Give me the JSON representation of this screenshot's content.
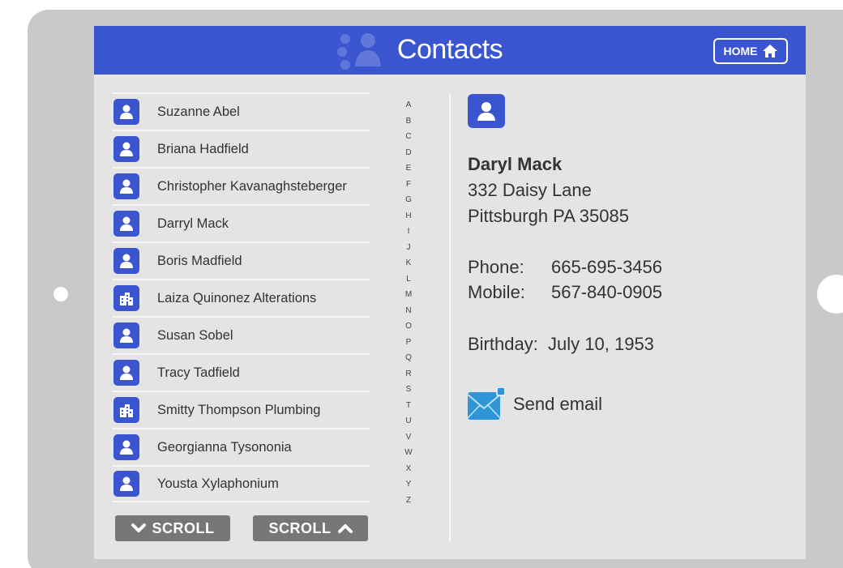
{
  "header": {
    "title": "Contacts",
    "home_label": "HOME"
  },
  "contacts": [
    {
      "name": "Suzanne Abel",
      "type": "person-icon"
    },
    {
      "name": "Briana Hadfield",
      "type": "person-icon"
    },
    {
      "name": "Christopher Kavanaghsteberger",
      "type": "person-icon"
    },
    {
      "name": "Darryl Mack",
      "type": "person-icon"
    },
    {
      "name": "Boris Madfield",
      "type": "person-icon"
    },
    {
      "name": "Laiza Quinonez Alterations",
      "type": "building-icon"
    },
    {
      "name": "Susan Sobel",
      "type": "person-icon"
    },
    {
      "name": "Tracy Tadfield",
      "type": "person-icon"
    },
    {
      "name": "Smitty Thompson Plumbing",
      "type": "building-icon"
    },
    {
      "name": "Georgianna Tysononia",
      "type": "person-icon"
    },
    {
      "name": "Yousta Xylaphonium",
      "type": "person-icon"
    }
  ],
  "scroll": {
    "down_label": "SCROLL",
    "up_label": "SCROLL"
  },
  "alphabet": [
    "A",
    "B",
    "C",
    "D",
    "E",
    "F",
    "G",
    "H",
    "I",
    "J",
    "K",
    "L",
    "M",
    "N",
    "O",
    "P",
    "Q",
    "R",
    "S",
    "T",
    "U",
    "V",
    "W",
    "X",
    "Y",
    "Z"
  ],
  "detail": {
    "name": "Daryl Mack",
    "address1": "332 Daisy Lane",
    "address2": "Pittsburgh PA 35085",
    "phone_label": "Phone:",
    "phone_value": "665-695-3456",
    "mobile_label": "Mobile:",
    "mobile_value": "567-840-0905",
    "birthday": "Birthday:  July 10, 1953",
    "send_email_label": "Send email"
  },
  "colors": {
    "accent": "#3b55cf",
    "scroll_button": "#777777",
    "screen_bg": "#e4e4e4",
    "bezel": "#c9c9c9"
  }
}
